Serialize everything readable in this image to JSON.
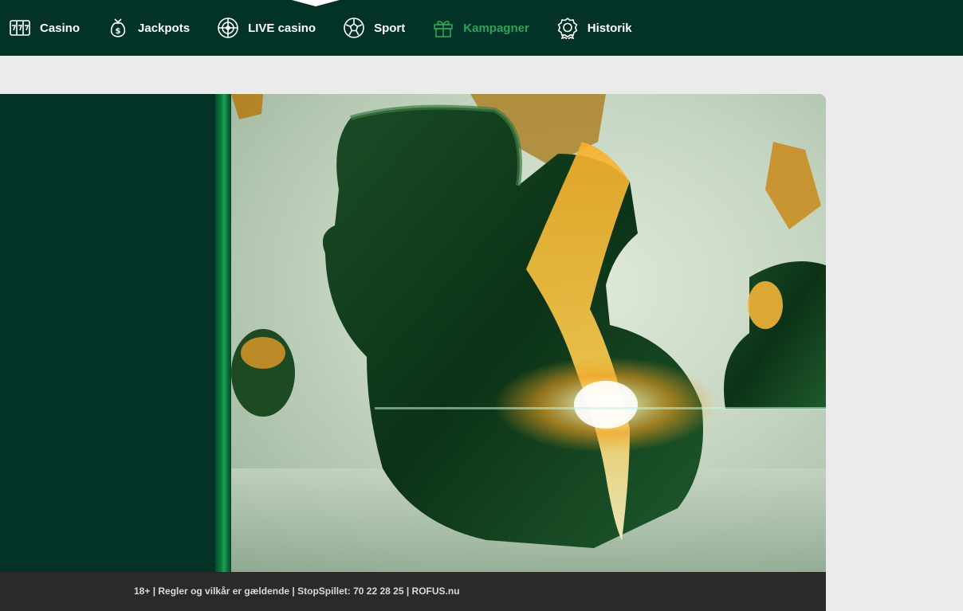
{
  "nav": {
    "items": [
      {
        "label": "Casino",
        "icon": "slot-machine-icon",
        "active": false
      },
      {
        "label": "Jackpots",
        "icon": "money-bag-icon",
        "active": false
      },
      {
        "label": "LIVE casino",
        "icon": "roulette-wheel-icon",
        "active": false
      },
      {
        "label": "Sport",
        "icon": "soccer-ball-icon",
        "active": false
      },
      {
        "label": "Kampagner",
        "icon": "gift-icon",
        "active": true
      },
      {
        "label": "Historik",
        "icon": "award-badge-icon",
        "active": false
      }
    ]
  },
  "footer": {
    "text": "18+ | Regler og vilkår er gældende | StopSpillet: 70 22 28 25 | ROFUS.nu"
  },
  "colors": {
    "nav_background": "#023326",
    "nav_text": "#ffffff",
    "nav_active": "#2fa35a",
    "page_background": "#ebebeb",
    "footer_background": "#2b2a2a",
    "footer_text": "#d9d9d9"
  }
}
